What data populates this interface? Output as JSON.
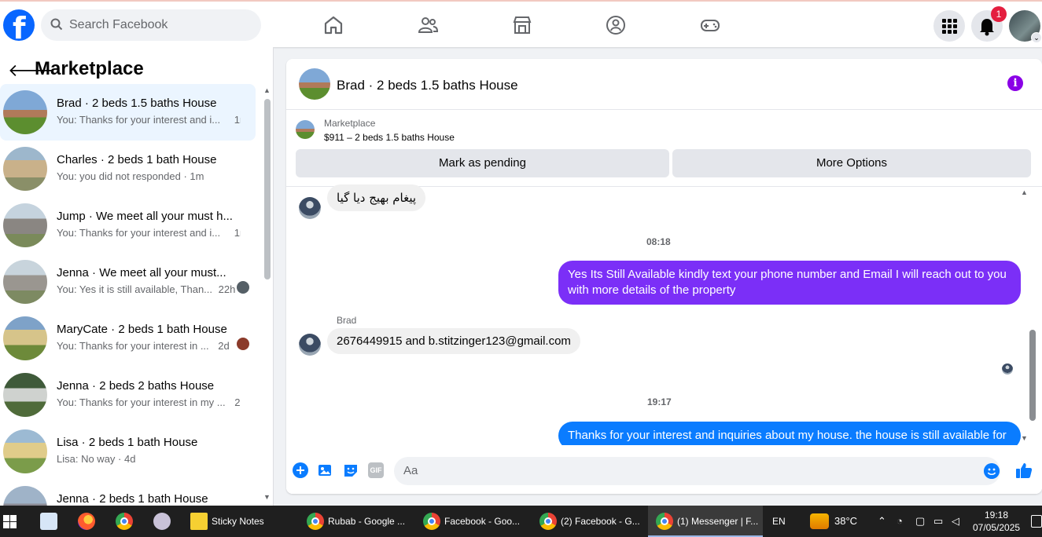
{
  "topbar": {
    "search_placeholder": "Search Facebook",
    "notification_count": "1"
  },
  "marketplace": {
    "back_icon": "arrow-left-icon",
    "title": "Marketplace",
    "conversations": [
      {
        "title": "Brad · 2 beds 1.5 baths House",
        "preview": "You: Thanks for your interest and i...",
        "time": "1m",
        "active": true
      },
      {
        "title": "Charles · 2 beds 1 bath House",
        "preview": "You: you did not responded",
        "time": "1m",
        "active": false
      },
      {
        "title": "Jump · We meet all your must h...",
        "preview": "You: Thanks for your interest and i...",
        "time": "1m",
        "active": false
      },
      {
        "title": "Jenna · We meet all your must...",
        "preview": "You: Yes it is still available, Than...",
        "time": "22h",
        "active": false
      },
      {
        "title": "MaryCate · 2 beds 1 bath House",
        "preview": "You: Thanks for your interest in ...",
        "time": "2d",
        "active": false
      },
      {
        "title": "Jenna · 2 beds 2 baths House",
        "preview": "You: Thanks for your interest in my ...",
        "time": "2d",
        "active": false
      },
      {
        "title": "Lisa · 2 beds 1 bath House",
        "preview": "Lisa: No way",
        "time": "4d",
        "active": false
      },
      {
        "title": "Jenna · 2 beds 1 bath House",
        "preview": "",
        "time": "",
        "active": false
      }
    ]
  },
  "chat": {
    "title": "Brad · 2 beds 1.5 baths House",
    "listing_label": "Marketplace",
    "listing_price": "$911 – 2 beds 1.5 baths House",
    "mark_pending": "Mark as pending",
    "more_options": "More Options",
    "messages": [
      {
        "type": "in",
        "text": "پیغام بھیج دیا گیا"
      },
      {
        "type": "time",
        "text": "08:18"
      },
      {
        "type": "out",
        "text": "Yes Its Still Available  kindly text your phone number and Email I will reach out to you with more details of the property"
      },
      {
        "type": "sender",
        "text": "Brad"
      },
      {
        "type": "in",
        "text": "2676449915 and b.stitzinger123@gmail.com"
      },
      {
        "type": "time",
        "text": "19:17"
      },
      {
        "type": "out",
        "text": "Thanks for your interest and inquiries about my house. the house is still available for"
      }
    ],
    "composer_placeholder": "Aa"
  },
  "taskbar": {
    "items": [
      {
        "label": "Sticky Notes",
        "active": false
      },
      {
        "label": "Rubab - Google ...",
        "active": false
      },
      {
        "label": "Facebook - Goo...",
        "active": false
      },
      {
        "label": "(2) Facebook - G...",
        "active": false
      },
      {
        "label": "(1) Messenger | F...",
        "active": true
      }
    ],
    "language": "EN",
    "temperature": "38°C",
    "time": "19:18",
    "date": "07/05/2025"
  }
}
